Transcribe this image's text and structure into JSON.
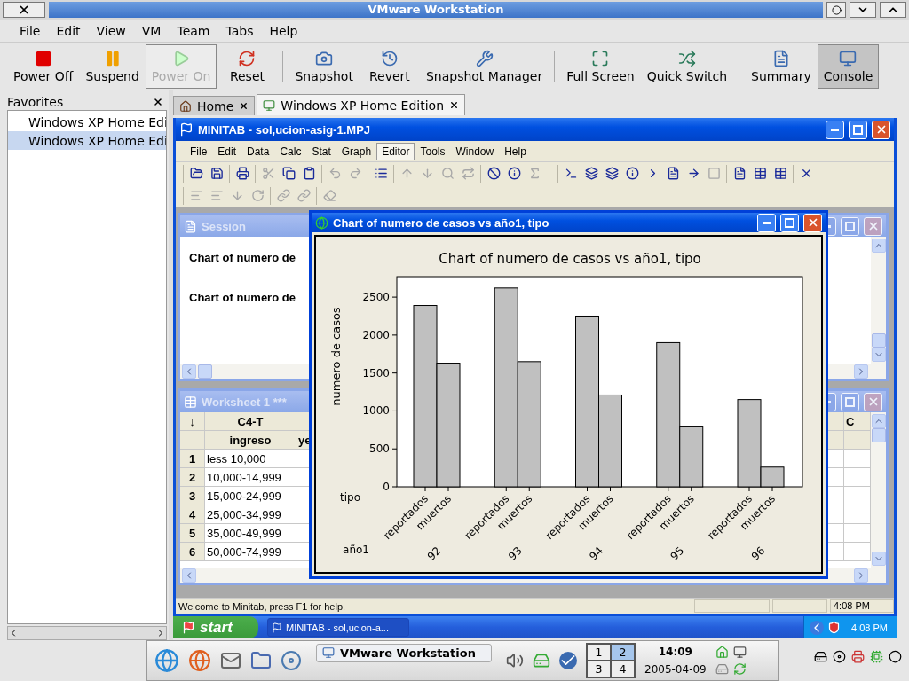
{
  "window": {
    "title": "VMware Workstation"
  },
  "menu": [
    "File",
    "Edit",
    "View",
    "VM",
    "Team",
    "Tabs",
    "Help"
  ],
  "toolbar": [
    {
      "buttons": [
        {
          "label": "Power Off",
          "disabled": false,
          "selected": false
        },
        {
          "label": "Suspend",
          "disabled": false,
          "selected": false
        },
        {
          "label": "Power On",
          "disabled": true,
          "selected": true
        },
        {
          "label": "Reset",
          "disabled": false,
          "selected": false
        }
      ]
    },
    {
      "buttons": [
        {
          "label": "Snapshot",
          "disabled": false,
          "selected": false
        },
        {
          "label": "Revert",
          "disabled": false,
          "selected": false
        },
        {
          "label": "Snapshot Manager",
          "disabled": false,
          "selected": false
        }
      ]
    },
    {
      "buttons": [
        {
          "label": "Full Screen",
          "disabled": false,
          "selected": false
        },
        {
          "label": "Quick Switch",
          "disabled": false,
          "selected": false
        }
      ]
    },
    {
      "buttons": [
        {
          "label": "Summary",
          "disabled": false,
          "selected": false
        },
        {
          "label": "Console",
          "disabled": false,
          "selected": true
        }
      ]
    }
  ],
  "sidebar": {
    "title": "Favorites",
    "items": [
      {
        "label": "Windows XP Home Edi",
        "selected": false
      },
      {
        "label": "Windows XP Home Edi",
        "selected": true
      }
    ]
  },
  "tabs": [
    {
      "label": "Home",
      "selected": false
    },
    {
      "label": "Windows XP Home Edition",
      "selected": true
    }
  ],
  "minitab": {
    "title": "MINITAB - sol,ucion-asig-1.MPJ",
    "menu": [
      {
        "label": "File",
        "selected": false
      },
      {
        "label": "Edit",
        "selected": false
      },
      {
        "label": "Data",
        "selected": false
      },
      {
        "label": "Calc",
        "selected": false
      },
      {
        "label": "Stat",
        "selected": false
      },
      {
        "label": "Graph",
        "selected": false
      },
      {
        "label": "Editor",
        "selected": true
      },
      {
        "label": "Tools",
        "selected": false
      },
      {
        "label": "Window",
        "selected": false
      },
      {
        "label": "Help",
        "selected": false
      }
    ],
    "toolbar_rows": [
      {
        "groups": [
          {
            "tools": [
              {
                "disabled": false
              },
              {
                "disabled": false
              }
            ]
          },
          {
            "tools": [
              {
                "disabled": false
              }
            ]
          },
          {
            "tools": [
              {
                "disabled": true
              },
              {
                "disabled": false
              },
              {
                "disabled": false
              }
            ]
          },
          {
            "tools": [
              {
                "disabled": true
              },
              {
                "disabled": true
              }
            ]
          },
          {
            "tools": [
              {
                "disabled": false
              }
            ]
          },
          {
            "tools": [
              {
                "disabled": true
              },
              {
                "disabled": true
              },
              {
                "disabled": true
              },
              {
                "disabled": true
              }
            ]
          },
          {
            "tools": [
              {
                "disabled": false
              },
              {
                "disabled": false
              },
              {
                "disabled": true
              }
            ]
          },
          {
            "tools": [
              {
                "disabled": false
              },
              {
                "disabled": false
              },
              {
                "disabled": false
              },
              {
                "disabled": false
              },
              {
                "disabled": false
              },
              {
                "disabled": false
              },
              {
                "disabled": false
              },
              {
                "disabled": true
              }
            ]
          },
          {
            "tools": [
              {
                "disabled": false
              },
              {
                "disabled": false
              },
              {
                "disabled": false
              }
            ]
          },
          {
            "tools": [
              {
                "disabled": false
              }
            ]
          }
        ]
      },
      {
        "groups": [
          {
            "tools": [
              {
                "disabled": true
              },
              {
                "disabled": true
              },
              {
                "disabled": true
              },
              {
                "disabled": true
              }
            ]
          },
          {
            "tools": [
              {
                "disabled": true
              },
              {
                "disabled": true
              }
            ]
          },
          {
            "tools": [
              {
                "disabled": true
              }
            ]
          }
        ]
      }
    ],
    "session": {
      "title": "Session",
      "lines": [
        "Chart of numero de",
        "Chart of numero de"
      ]
    },
    "worksheet": {
      "title": "Worksheet 1 ***",
      "corner": "↓",
      "columns": [
        {
          "id": "C4-T",
          "name": "ingreso"
        },
        {
          "name": "ye"
        },
        {
          "id": "C"
        }
      ],
      "rows": [
        {
          "number": "1",
          "cells": [
            "less 10,000"
          ]
        },
        {
          "number": "2",
          "cells": [
            "10,000-14,999"
          ]
        },
        {
          "number": "3",
          "cells": [
            "15,000-24,999"
          ]
        },
        {
          "number": "4",
          "cells": [
            "25,000-34,999"
          ]
        },
        {
          "number": "5",
          "cells": [
            "35,000-49,999"
          ]
        },
        {
          "number": "6",
          "cells": [
            "50,000-74,999"
          ]
        }
      ]
    },
    "chart_window": {
      "title": "Chart of numero de casos vs año1, tipo",
      "axis_rows": [
        "tipo",
        "año1"
      ],
      "chart_data": {
        "type": "bar",
        "title": "Chart of numero de casos vs año1, tipo",
        "ylabel": "numero de casos",
        "categories": [
          "92",
          "93",
          "94",
          "95",
          "96"
        ],
        "series": [
          {
            "name": "reportados",
            "color": "#c0c0c0",
            "values": [
              2390,
              2620,
              2250,
              1900,
              1150
            ]
          },
          {
            "name": "muertos",
            "color": "#c0c0c0",
            "values": [
              1630,
              1650,
              1210,
              800,
              260
            ]
          }
        ],
        "legend": "bottom",
        "ylim": [
          0,
          2770
        ],
        "yticks": [
          0,
          500,
          1000,
          1500,
          2000,
          2500
        ]
      }
    },
    "status_bar": {
      "message": "Welcome to Minitab, press F1 for help.",
      "time": "4:08 PM"
    }
  },
  "xp_taskbar": {
    "start": "start",
    "tasks": [
      "MINITAB - sol,ucion-a..."
    ],
    "clock": "4:08 PM"
  },
  "kde_panel": {
    "task": "VMware Workstation",
    "desktops": [
      {
        "label": "1",
        "selected": false
      },
      {
        "label": "2",
        "selected": true
      },
      {
        "label": "3",
        "selected": false
      },
      {
        "label": "4",
        "selected": false
      }
    ],
    "time": "14:09",
    "date": "2005-04-09"
  }
}
